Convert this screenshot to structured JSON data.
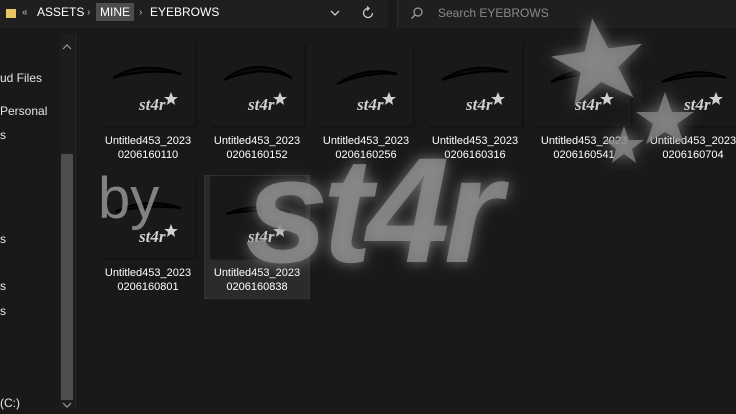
{
  "address_bar": {
    "breadcrumbs": [
      "ASSETS",
      "MINE",
      "EYEBROWS"
    ],
    "overflow_glyph": "«",
    "separator_glyph": "›"
  },
  "search": {
    "placeholder": "Search EYEBROWS"
  },
  "nav_pane": {
    "items": [
      "ud Files",
      "Personal",
      "s",
      "s",
      "s",
      "s",
      "(C:)"
    ]
  },
  "files": [
    {
      "name_line1": "Untitled453_2023",
      "name_line2": "0206160110"
    },
    {
      "name_line1": "Untitled453_2023",
      "name_line2": "0206160152"
    },
    {
      "name_line1": "Untitled453_2023",
      "name_line2": "0206160256"
    },
    {
      "name_line1": "Untitled453_2023",
      "name_line2": "0206160316"
    },
    {
      "name_line1": "Untitled453_2023",
      "name_line2": "0206160541"
    },
    {
      "name_line1": "Untitled453_2023",
      "name_line2": "0206160704"
    },
    {
      "name_line1": "Untitled453_2023",
      "name_line2": "0206160801"
    },
    {
      "name_line1": "Untitled453_2023",
      "name_line2": "0206160838"
    }
  ],
  "thumbnail_mark": "st4r",
  "watermark": {
    "by": "by",
    "name": "st4r"
  },
  "colors": {
    "background": "#191919",
    "selected_tile": "#2b2b2b",
    "watermark": "#9a9a9a"
  }
}
